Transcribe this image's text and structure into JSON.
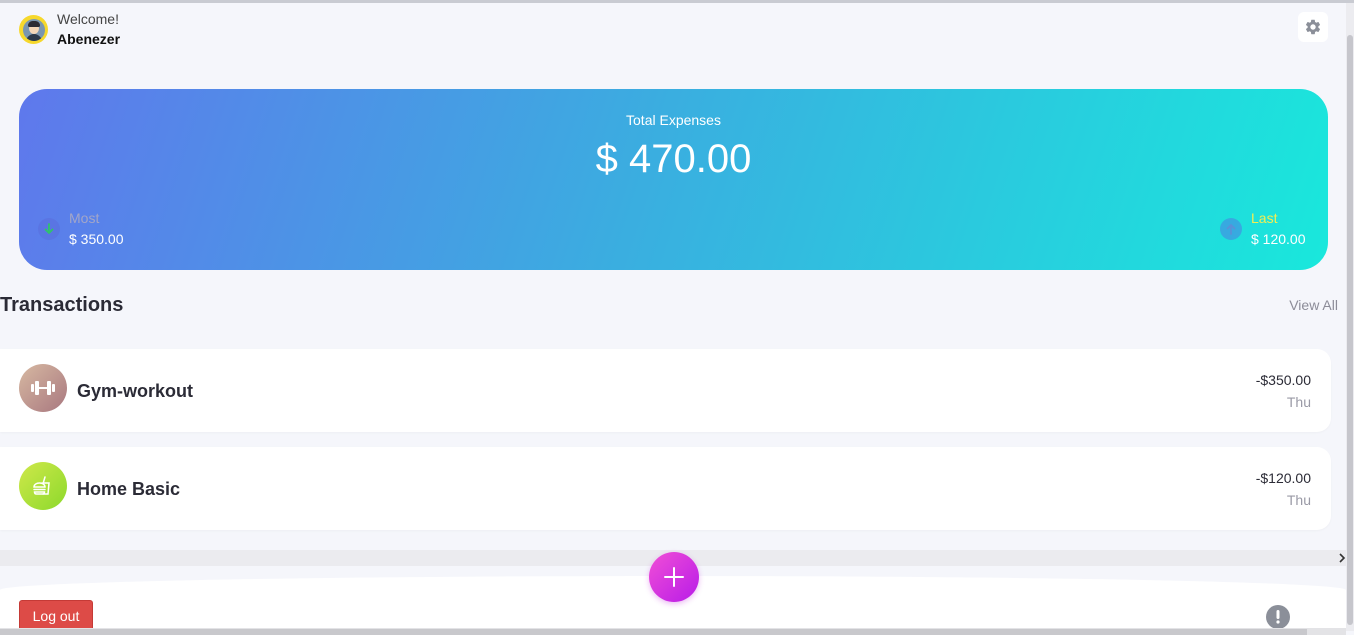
{
  "header": {
    "welcome_label": "Welcome!",
    "user_name": "Abenezer",
    "avatar_icon": "user-avatar",
    "settings_icon": "gear-icon"
  },
  "summary": {
    "title": "Total Expenses",
    "amount": "$ 470.00",
    "most": {
      "label": "Most",
      "value": "$ 350.00",
      "icon": "arrow-down-icon"
    },
    "last": {
      "label": "Last",
      "value": "$ 120.00",
      "icon": "arrow-up-icon"
    }
  },
  "transactions": {
    "title": "Transactions",
    "view_all_label": "View All",
    "items": [
      {
        "name": "Gym-workout",
        "amount": "-$350.00",
        "day": "Thu",
        "icon": "dumbbell-icon"
      },
      {
        "name": "Home Basic",
        "amount": "-$120.00",
        "day": "Thu",
        "icon": "food-icon"
      }
    ]
  },
  "footer": {
    "logout_label": "Log out",
    "add_icon": "plus-icon",
    "info_icon": "exclamation-icon"
  },
  "colors": {
    "card_gradient_start": "#5f78ec",
    "card_gradient_end": "#19e8dc",
    "fab_start": "#f14fd6",
    "fab_end": "#b81be8",
    "logout": "#dd4b47",
    "last_label": "#f2ee52",
    "most_arrow": "#2fc46a"
  }
}
